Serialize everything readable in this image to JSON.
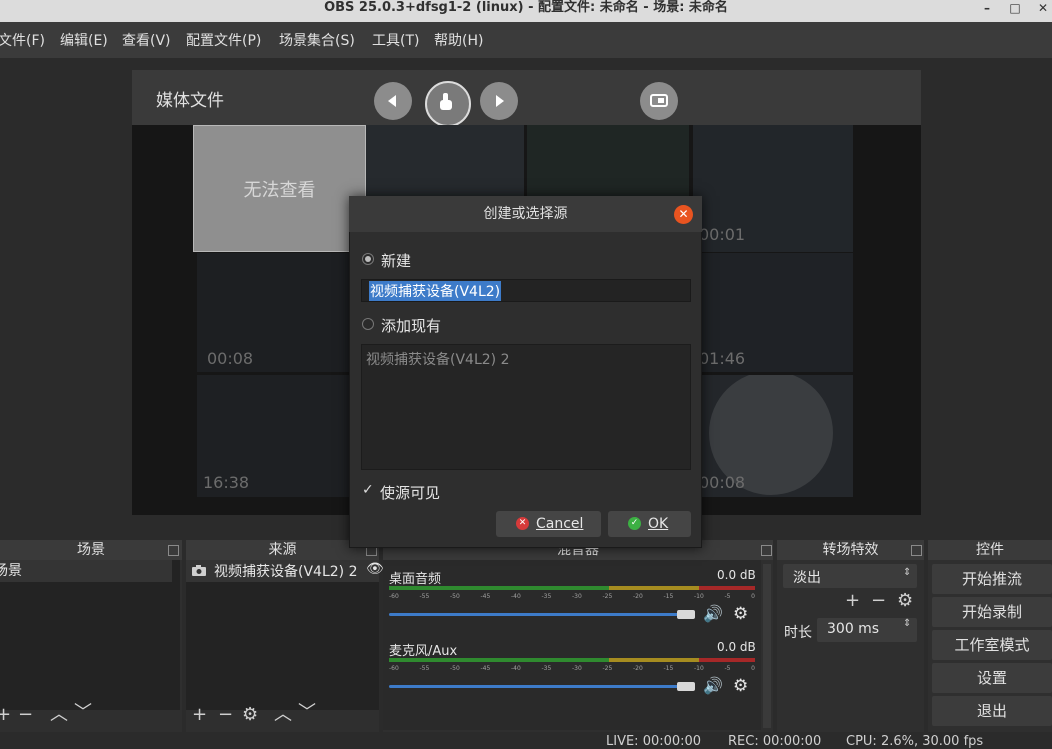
{
  "window": {
    "title": "OBS 25.0.3+dfsg1-2 (linux) - 配置文件: 未命名 - 场景: 未命名",
    "minimize_glyph": "–",
    "maximize_glyph": "□",
    "close_glyph": "✕"
  },
  "menu": {
    "file": "文件(F)",
    "edit": "编辑(E)",
    "view": "查看(V)",
    "profile": "配置文件(P)",
    "scene_collection": "场景集合(S)",
    "tools": "工具(T)",
    "help": "帮助(H)"
  },
  "preview": {
    "title": "媒体文件",
    "unavailable_label": "无法查看",
    "timestamps": [
      "00:01",
      "00:08",
      "01:46",
      "16:38",
      "00:08"
    ]
  },
  "dialog": {
    "title": "创建或选择源",
    "new_label": "新建",
    "new_name_value": "视频捕获设备(V4L2)",
    "add_existing_label": "添加现有",
    "existing_items": [
      "视频捕获设备(V4L2) 2"
    ],
    "visible_label": "使源可见",
    "visible_checked": true,
    "cancel_label": "Cancel",
    "ok_label": "OK"
  },
  "docks": {
    "scenes": {
      "title": "场景",
      "items": [
        "场景"
      ]
    },
    "sources": {
      "title": "来源",
      "items": [
        "视频捕获设备(V4L2) 2"
      ]
    },
    "mixer": {
      "title": "混音器",
      "channels": [
        {
          "name": "桌面音频",
          "db": "0.0 dB",
          "volume": 1.0
        },
        {
          "name": "麦克风/Aux",
          "db": "0.0 dB",
          "volume": 1.0
        }
      ],
      "scale": [
        "-60",
        "-55",
        "-50",
        "-45",
        "-40",
        "-35",
        "-30",
        "-25",
        "-20",
        "-15",
        "-10",
        "-5",
        "0"
      ]
    },
    "transitions": {
      "title": "转场特效",
      "selected": "淡出",
      "duration_label": "时长",
      "duration_value": "300 ms"
    },
    "controls": {
      "title": "控件",
      "buttons": [
        "开始推流",
        "开始录制",
        "工作室模式",
        "设置",
        "退出"
      ]
    }
  },
  "status": {
    "live": "LIVE: 00:00:00",
    "rec": "REC: 00:00:00",
    "cpu": "CPU: 2.6%, 30.00 fps"
  },
  "colors": {
    "accent": "#3d7bc9",
    "close_orange": "#e95420",
    "ok_green": "#3cb043",
    "cancel_red": "#d63a3a"
  }
}
